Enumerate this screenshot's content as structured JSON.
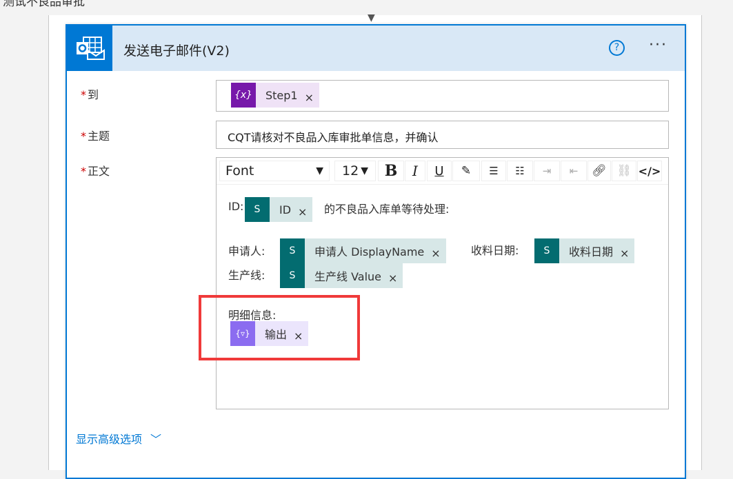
{
  "page": {
    "top_title": "测试不良品审批"
  },
  "card": {
    "title": "发送电子邮件(V2)",
    "help": "?",
    "more": "···"
  },
  "fields": {
    "to": {
      "label": "到",
      "required": "*",
      "token": "Step1"
    },
    "subject": {
      "label": "主题",
      "required": "*",
      "value": "CQT请核对不良品入库审批单信息，并确认"
    },
    "body": {
      "label": "正文",
      "required": "*"
    }
  },
  "toolbar": {
    "font": "Font",
    "size": "12",
    "bold": "B",
    "italic": "I",
    "underline": "U",
    "code": "</>"
  },
  "body": {
    "id_label": "ID:",
    "id_token": "ID",
    "id_suffix": "的不良品入库单等待处理:",
    "applicant_label": "申请人:",
    "applicant_token": "申请人 DisplayName",
    "date_label": "收料日期:",
    "date_token": "收料日期",
    "line_label": "生产线:",
    "line_token": "生产线 Value",
    "detail_label": "明细信息:",
    "detail_token": "输出"
  },
  "remove": "×",
  "advanced": {
    "label": "显示高级选项"
  },
  "colors": {
    "accent": "#0078d4",
    "sharepoint": "#036c70",
    "variable": "#7719aa",
    "expression": "#8b6cf0",
    "highlight": "#f03a3a"
  }
}
